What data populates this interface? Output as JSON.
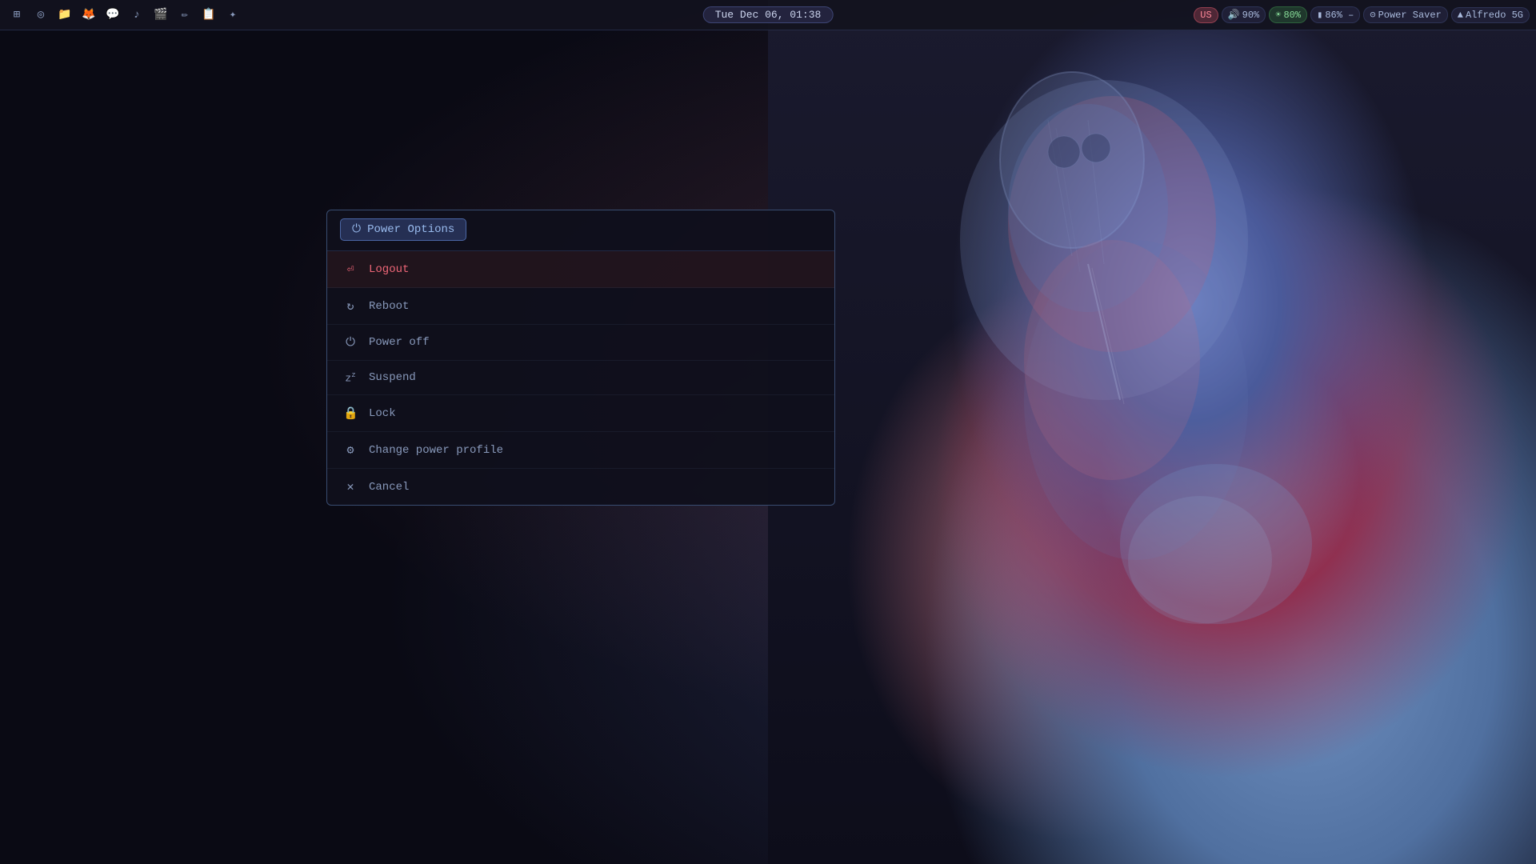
{
  "taskbar": {
    "icons": [
      {
        "name": "grid-icon",
        "symbol": "⊞"
      },
      {
        "name": "circle-icon",
        "symbol": "◎"
      },
      {
        "name": "folder-icon",
        "symbol": "📁"
      },
      {
        "name": "firefox-icon",
        "symbol": "🦊"
      },
      {
        "name": "chat-icon",
        "symbol": "💬"
      },
      {
        "name": "music-icon",
        "symbol": "♪"
      },
      {
        "name": "video-icon",
        "symbol": "🎬"
      },
      {
        "name": "pencil-icon",
        "symbol": "✏"
      },
      {
        "name": "notes-icon",
        "symbol": "📋"
      },
      {
        "name": "settings-icon",
        "symbol": "✦"
      }
    ],
    "clock": "Tue Dec 06, 01:38",
    "status": {
      "lang": "US",
      "volume_icon": "🔊",
      "volume": "90%",
      "brightness_icon": "☀",
      "brightness": "80%",
      "battery_icon": "🔋",
      "battery": "86% –",
      "power_saver_icon": "⊝",
      "power_saver": "Power Saver",
      "wifi_icon": "📶",
      "wifi": "Alfredo 5G"
    }
  },
  "power_dialog": {
    "title": "Power Options",
    "title_icon": "⏻",
    "menu_items": [
      {
        "id": "logout",
        "icon": "⏎",
        "label": "Logout",
        "active": true,
        "style": "logout"
      },
      {
        "id": "reboot",
        "icon": "↻",
        "label": "Reboot",
        "active": false,
        "style": "normal"
      },
      {
        "id": "poweroff",
        "icon": "⏻",
        "label": "Power off",
        "active": false,
        "style": "normal"
      },
      {
        "id": "suspend",
        "icon": "⏾",
        "label": "Suspend",
        "active": false,
        "style": "normal"
      },
      {
        "id": "lock",
        "icon": "🔒",
        "label": "Lock",
        "active": false,
        "style": "normal"
      },
      {
        "id": "change-power-profile",
        "icon": "⚙",
        "label": "Change power profile",
        "active": false,
        "style": "normal"
      },
      {
        "id": "cancel",
        "icon": "✕",
        "label": "Cancel",
        "active": false,
        "style": "normal"
      }
    ]
  }
}
